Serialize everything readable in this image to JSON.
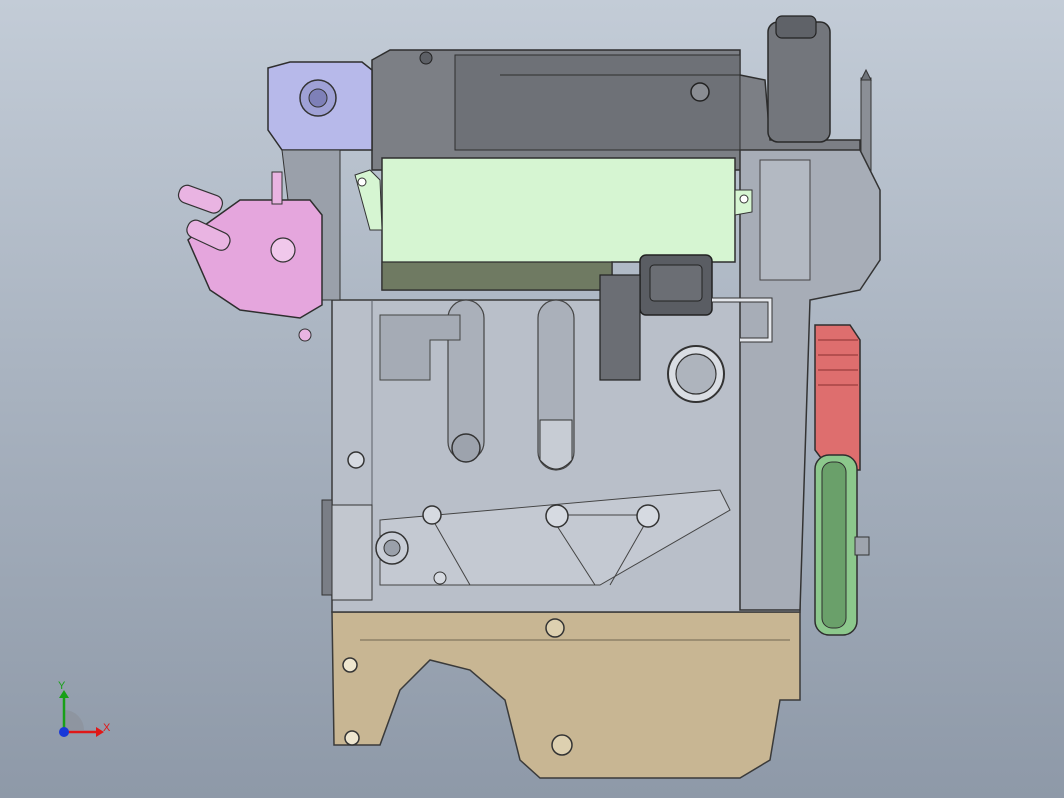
{
  "viewport": {
    "background_top": "#c3ccd7",
    "background_bottom": "#8e99a8"
  },
  "model": {
    "colors": {
      "block": "#b9bfc9",
      "head": "#7c7f85",
      "cover_green": "#d6f5d2",
      "thermostat_pink": "#e5a6dd",
      "bracket_lavender": "#b7b9ea",
      "oil_pan": "#c8b693",
      "pulley_red": "#de6e6e",
      "pulley_green": "#8cc88c"
    }
  },
  "triad": {
    "x_label": "X",
    "y_label": "Y",
    "x_color": "#e01818",
    "y_color": "#18a018",
    "z_color": "#1838d8"
  }
}
